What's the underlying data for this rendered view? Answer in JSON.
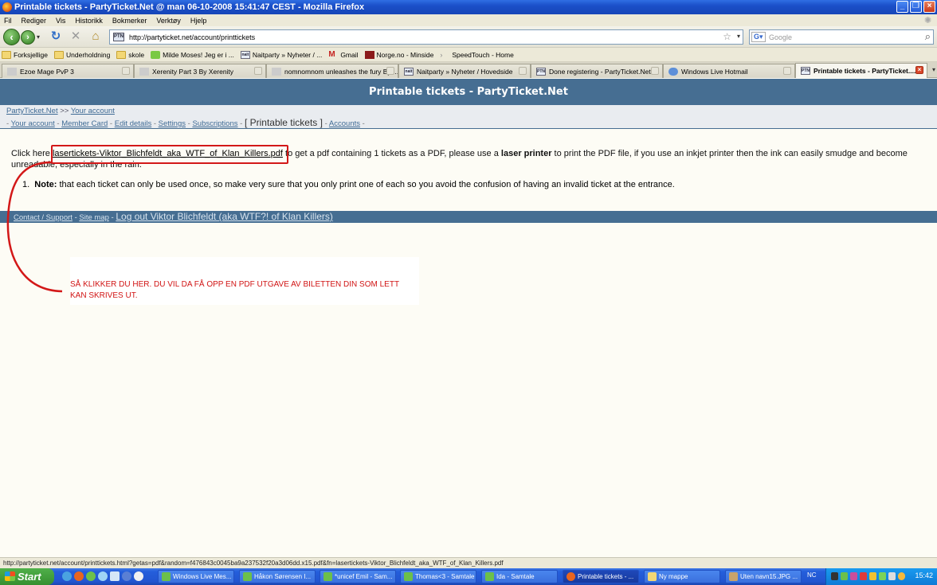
{
  "window": {
    "title": "Printable tickets - PartyTicket.Net @ man 06-10-2008 15:41:47 CEST - Mozilla Firefox"
  },
  "menu": [
    "Fil",
    "Rediger",
    "Vis",
    "Historikk",
    "Bokmerker",
    "Verktøy",
    "Hjelp"
  ],
  "nav": {
    "url": "http://partyticket.net/account/printtickets",
    "search_placeholder": "Google"
  },
  "bookmarks": [
    "Forksjellige",
    "Underholdning",
    "skole",
    "Milde Moses! Jeg er i ...",
    "Naitparty » Nyheter / ...",
    "Gmail",
    "Norge.no - Minside",
    "SpeedTouch - Home"
  ],
  "tabs": [
    "Ezoe Mage PvP 3",
    "Xerenity Part 3 By Xerenity",
    "nomnomnom unleashes the fury By ...",
    "Naitparty » Nyheter / Hovedside",
    "Done registering - PartyTicket.Net ...",
    "Windows Live Hotmail",
    "Printable tickets - PartyTicket...."
  ],
  "page": {
    "header": "Printable tickets - PartyTicket.Net",
    "breadcrumb": {
      "home": "PartyTicket.Net",
      "arrow": ">>",
      "account": "Your account"
    },
    "subnav": {
      "your_account": "Your account",
      "member_card": "Member Card",
      "edit_details": "Edit details",
      "settings": "Settings",
      "subscriptions": "Subscriptions",
      "current": "[ Printable tickets ]",
      "accounts": "Accounts"
    },
    "intro_pre": "Click here ",
    "file_link": "lasertickets-Viktor_Blichfeldt_aka_WTF_of_Klan_Killers.pdf",
    "intro_mid": " to get a pdf containing 1 tickets as a PDF, please use a ",
    "laser": "laser printer",
    "intro_post": " to print the PDF file, if you use an inkjet printer then the ink can easily smudge and become unreadable, especially in the rain.",
    "note_label": "Note:",
    "note_text": " that each ticket can only be used once, so make very sure that you only print one of each so you avoid the confusion of having an invalid ticket at the entrance.",
    "footer": {
      "contact": "Contact / Support",
      "sitemap": "Site map",
      "logout": "Log out Viktor Blichfeldt (aka WTF?! of Klan Killers)"
    }
  },
  "annotation": {
    "line1": "SÅ KLIKKER DU HER. DU VIL DA FÅ OPP EN PDF UTGAVE AV BILETTEN DIN SOM LETT",
    "line2": "KAN SKRIVES UT.",
    "color": "#d31818"
  },
  "statusbar": "http://partyticket.net/account/printtickets.html?getas=pdf&random=f476843c0045ba9a237532f20a3d06dd.x15.pdf&fn=lasertickets-Viktor_Blichfeldt_aka_WTF_of_Klan_Killers.pdf",
  "taskbar": {
    "start": "Start",
    "tasks": [
      "Windows Live Mes...",
      "Håkon Sørensen I...",
      "*unicef Emil - Sam...",
      "Thomas<3 - Samtale",
      "Ida - Samtale",
      "Printable tickets - ...",
      "Ny mappe",
      "Uten navn15.JPG ..."
    ],
    "lang": "NC",
    "clock": "15:42"
  }
}
